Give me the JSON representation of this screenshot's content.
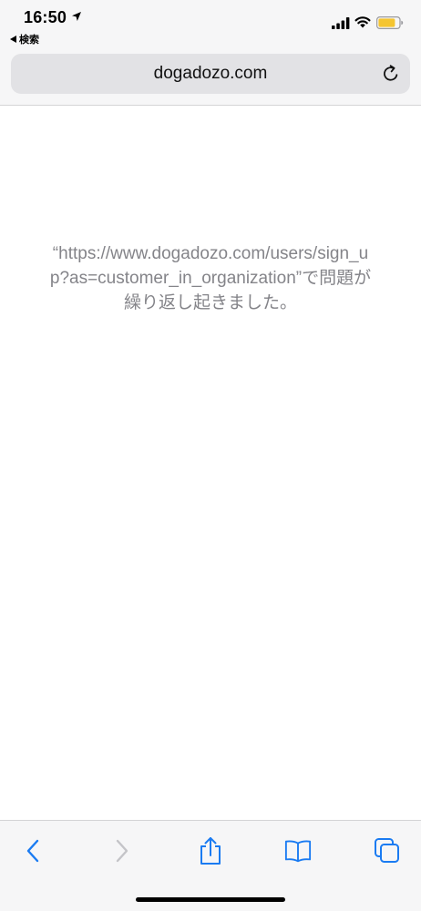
{
  "status_bar": {
    "time": "16:50",
    "back_label": "検索"
  },
  "address_bar": {
    "url": "dogadozo.com"
  },
  "error": {
    "message": "“https://www.dogadozo.com/users/sign_up?as=customer_in_organization”で問題が繰り返し起きました。"
  },
  "toolbar": {
    "buttons": [
      "back",
      "forward",
      "share",
      "bookmarks",
      "tabs"
    ]
  },
  "colors": {
    "accent": "#1a7bf2",
    "disabled": "#c4c4c8",
    "message_text": "#848489",
    "battery": "#f5c531"
  }
}
